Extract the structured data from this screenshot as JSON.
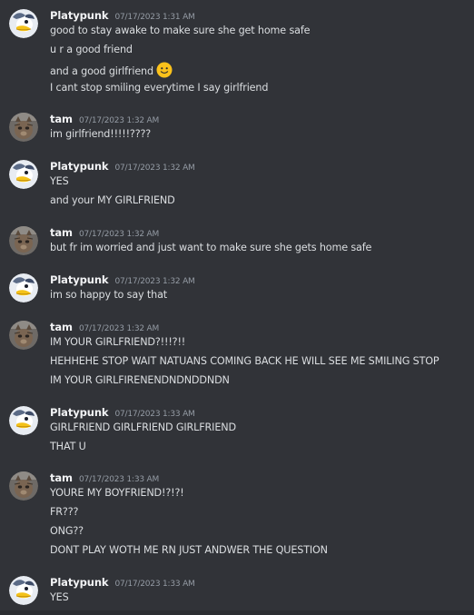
{
  "groups": [
    {
      "username": "Platypunk",
      "avatar": "platypunk-avatar",
      "timestamp": "07/17/2023 1:31 AM",
      "messages": [
        "good to stay awake to make sure she get home safe",
        "u r a good friend",
        "and a good girlfriend",
        "I cant stop smiling everytime I say girlfriend"
      ],
      "emoji": "slightly-smiling-face-icon"
    },
    {
      "username": "tam",
      "avatar": "tam-cat-avatar",
      "timestamp": "07/17/2023 1:32 AM",
      "messages": [
        "im girlfriend!!!!!????"
      ]
    },
    {
      "username": "Platypunk",
      "avatar": "platypunk-avatar",
      "timestamp": "07/17/2023 1:32 AM",
      "messages": [
        "YES",
        "and your MY GIRLFRIEND"
      ]
    },
    {
      "username": "tam",
      "avatar": "tam-cat-avatar",
      "timestamp": "07/17/2023 1:32 AM",
      "messages": [
        "but fr im worried and just want to make sure she gets home safe"
      ]
    },
    {
      "username": "Platypunk",
      "avatar": "platypunk-avatar",
      "timestamp": "07/17/2023 1:32 AM",
      "messages": [
        "im so happy to say that"
      ]
    },
    {
      "username": "tam",
      "avatar": "tam-cat-avatar",
      "timestamp": "07/17/2023 1:32 AM",
      "messages": [
        "IM YOUR GIRLFRIEND?!!!?!!",
        "HEHHEHE STOP WAIT NATUANS COMING BACK HE WILL SEE ME SMILING STOP",
        "IM YOUR GIRLFIRENENDNDNDDNDN"
      ]
    },
    {
      "username": "Platypunk",
      "avatar": "platypunk-avatar",
      "timestamp": "07/17/2023 1:33 AM",
      "messages": [
        "GIRLFRIEND GIRLFRIEND GIRLFRIEND",
        "THAT U"
      ]
    },
    {
      "username": "tam",
      "avatar": "tam-cat-avatar",
      "timestamp": "07/17/2023 1:33 AM",
      "messages": [
        "YOURE MY BOYFRIEND!?!?!",
        "FR???",
        "ONG??",
        "DONT PLAY WOTH ME RN JUST ANDWER THE QUESTION"
      ]
    },
    {
      "username": "Platypunk",
      "avatar": "platypunk-avatar",
      "timestamp": "07/17/2023 1:33 AM",
      "messages": [
        "YES"
      ]
    }
  ],
  "colors": {
    "background": "#313338",
    "username": "#f2f3f5",
    "timestamp": "#949ba4",
    "message": "#dbdee1"
  }
}
